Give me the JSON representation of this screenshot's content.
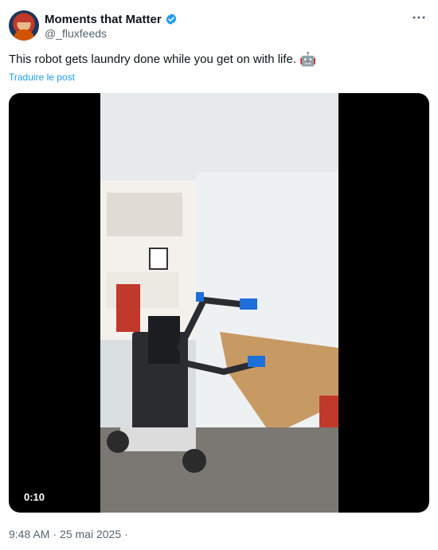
{
  "author": {
    "name": "Moments that Matter",
    "handle": "@_fluxfeeds",
    "verified": true,
    "verified_color": "#1d9bf0",
    "avatar_icon": "person-avatar"
  },
  "post": {
    "text": "This robot gets laundry done while you get on with life.",
    "emoji": "🤖",
    "translate_label": "Traduire le post"
  },
  "media": {
    "type": "video",
    "duration": "0:10",
    "scene": "robot-with-arms-in-room-icon"
  },
  "meta": {
    "time": "9:48 AM",
    "separator": "·",
    "date": "25 mai 2025",
    "trailing_separator": "·"
  },
  "menu": {
    "more_icon": "more-horizontal-icon"
  },
  "colors": {
    "link": "#1d9bf0",
    "secondary_text": "#536471",
    "primary_text": "#0f1419"
  }
}
